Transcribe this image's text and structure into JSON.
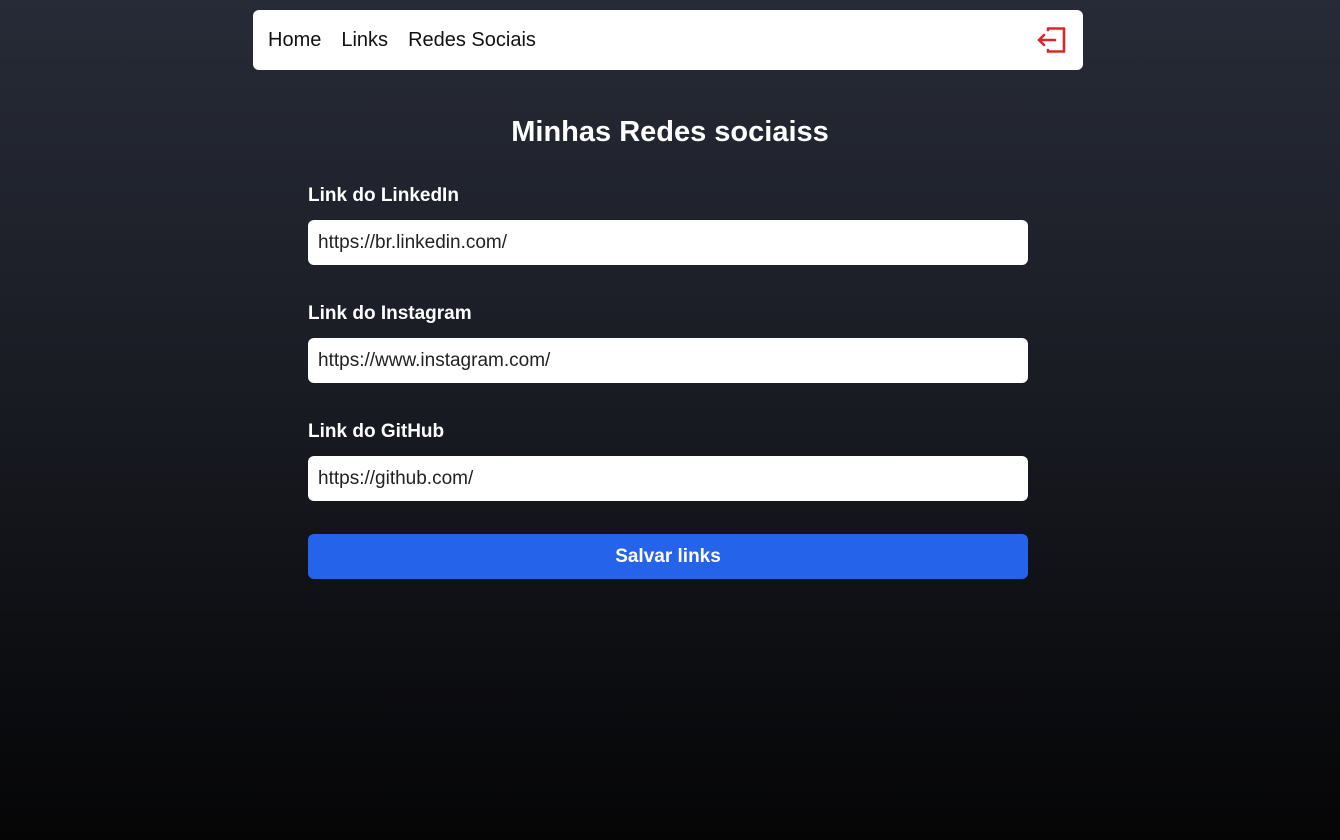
{
  "nav": {
    "links": [
      {
        "label": "Home"
      },
      {
        "label": "Links"
      },
      {
        "label": "Redes Sociais"
      }
    ],
    "logout_icon": "logout-icon",
    "logout_color": "#dc2626"
  },
  "page": {
    "title": "Minhas Redes sociaiss"
  },
  "form": {
    "fields": [
      {
        "label": "Link do LinkedIn",
        "value": "https://br.linkedin.com/"
      },
      {
        "label": "Link do Instagram",
        "value": "https://www.instagram.com/"
      },
      {
        "label": "Link do GitHub",
        "value": "https://github.com/"
      }
    ],
    "submit_label": "Salvar links",
    "submit_color": "#2563eb"
  }
}
